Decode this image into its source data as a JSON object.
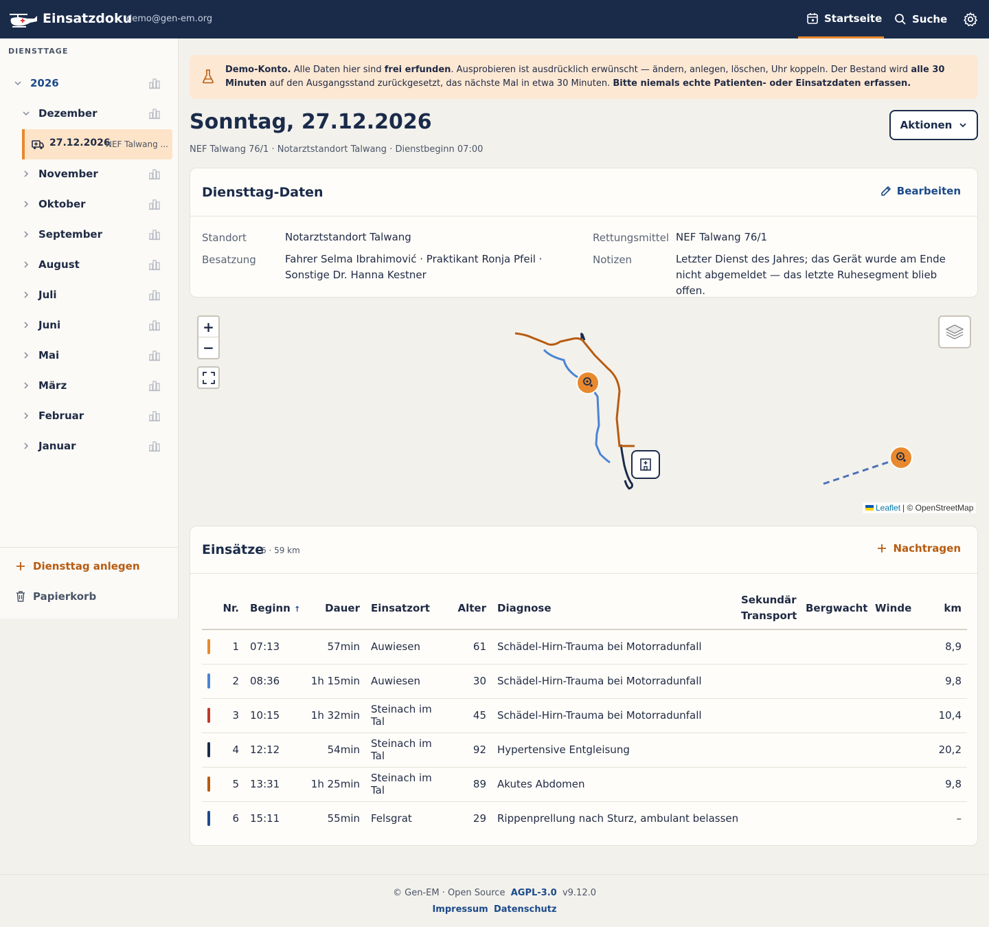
{
  "header": {
    "app_title": "Einsatzdoku",
    "user_email": "demo@gen-em.org",
    "nav_home": "Startseite",
    "nav_search": "Suche"
  },
  "sidebar": {
    "heading": "DIENSTTAGE",
    "year": "2026",
    "open_month": "Dezember",
    "active_day": {
      "date": "27.12.2026",
      "location": "NEF Talwang ..."
    },
    "months": [
      "November",
      "Oktober",
      "September",
      "August",
      "Juli",
      "Juni",
      "Mai",
      "März",
      "Februar",
      "Januar"
    ],
    "create_label": "Diensttag anlegen",
    "trash_label": "Papierkorb"
  },
  "banner": {
    "strong1": "Demo-Konto.",
    "text1": " Alle Daten hier sind ",
    "strong2": "frei erfunden",
    "text2": ". Ausprobieren ist ausdrücklich erwünscht — ändern, anlegen, löschen, Uhr koppeln. Der Bestand wird ",
    "strong3": "alle 30 Minuten",
    "text3": " auf den Ausgangsstand zurückgesetzt, das nächste Mal in etwa 30 Minuten. ",
    "strong4": "Bitte niemals echte Patienten- oder Einsatzdaten erfassen."
  },
  "page": {
    "title": "Sonntag, 27.12.2026",
    "subtitle": "NEF Talwang 76/1 · Notarztstandort Talwang · Dienstbeginn 07:00",
    "actions_label": "Aktionen"
  },
  "duty": {
    "title": "Diensttag-Daten",
    "edit_label": "Bearbeiten",
    "standort_label": "Standort",
    "standort": "Notarztstandort Talwang",
    "besatzung_label": "Besatzung",
    "besatzung": "Fahrer Selma Ibrahimović · Praktikant Ronja Pfeil · Sonstige Dr. Hanna Kestner",
    "rettungsmittel_label": "Rettungsmittel",
    "rettungsmittel": "NEF Talwang 76/1",
    "notizen_label": "Notizen",
    "notizen": "Letzter Dienst des Jahres; das Gerät wurde am Ende nicht abgemeldet — das letzte Ruhesegment blieb offen."
  },
  "map": {
    "zoom_in": "+",
    "zoom_out": "−",
    "attribution_leaflet": "Leaflet",
    "attribution_rest": "| © OpenStreetMap"
  },
  "missions": {
    "title": "Einsätze",
    "meta": "6 · 59 km",
    "add_label": "Nachtragen",
    "columns": {
      "nr": "Nr.",
      "beginn": "Beginn",
      "sort_arrow": "↑",
      "dauer": "Dauer",
      "ort": "Einsatzort",
      "alter": "Alter",
      "diagnose": "Diagnose",
      "sek1": "Sekundär",
      "sek2": "Transport",
      "bergwacht": "Bergwacht",
      "winde": "Winde",
      "km": "km"
    },
    "rows": [
      {
        "color": "#e8892e",
        "nr": "1",
        "beginn": "07:13",
        "dauer": "57min",
        "ort": "Auwiesen",
        "alter": "61",
        "diagnose": "Schädel-Hirn-Trauma bei Motorradunfall",
        "km": "8,9"
      },
      {
        "color": "#4a84d4",
        "nr": "2",
        "beginn": "08:36",
        "dauer": "1h 15min",
        "ort": "Auwiesen",
        "alter": "30",
        "diagnose": "Schädel-Hirn-Trauma bei Motorradunfall",
        "km": "9,8"
      },
      {
        "color": "#c0392b",
        "nr": "3",
        "beginn": "10:15",
        "dauer": "1h 32min",
        "ort": "Steinach im Tal",
        "alter": "45",
        "diagnose": "Schädel-Hirn-Trauma bei Motorradunfall",
        "km": "10,4"
      },
      {
        "color": "#1a2b4a",
        "nr": "4",
        "beginn": "12:12",
        "dauer": "54min",
        "ort": "Steinach im Tal",
        "alter": "92",
        "diagnose": "Hypertensive Entgleisung",
        "km": "20,2"
      },
      {
        "color": "#b75b0f",
        "nr": "5",
        "beginn": "13:31",
        "dauer": "1h 25min",
        "ort": "Steinach im Tal",
        "alter": "89",
        "diagnose": "Akutes Abdomen",
        "km": "9,8"
      },
      {
        "color": "#1e4a8a",
        "nr": "6",
        "beginn": "15:11",
        "dauer": "55min",
        "ort": "Felsgrat",
        "alter": "29",
        "diagnose": "Rippenprellung nach Sturz, ambulant belassen",
        "km": "–"
      }
    ]
  },
  "footer": {
    "copyright": "© Gen-EM · Open Source",
    "license": "AGPL-3.0",
    "version": "v9.12.0",
    "impressum": "Impressum",
    "datenschutz": "Datenschutz"
  },
  "colors": {
    "navy": "#1a2b4a",
    "accent_orange": "#e8892e",
    "link_orange": "#b75b0f",
    "link_blue": "#1a4a8a"
  }
}
